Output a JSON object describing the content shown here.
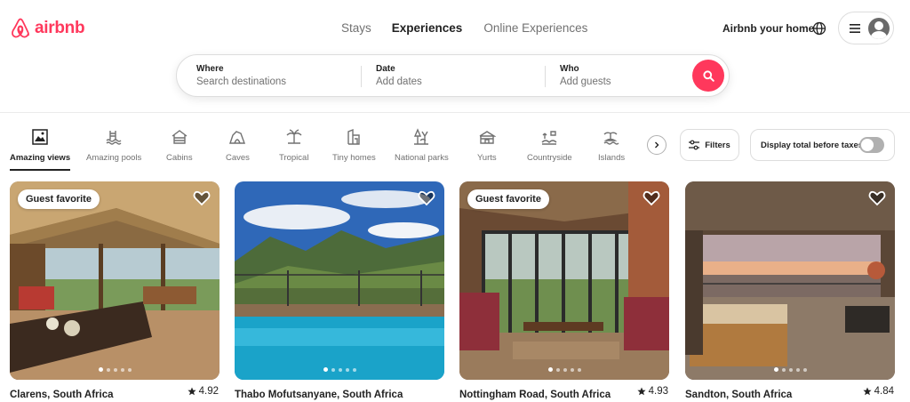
{
  "colors": {
    "brand": "#FF385C",
    "text": "#222222",
    "muted": "#717171",
    "border": "#DDDDDD"
  },
  "header": {
    "logo_text": "airbnb",
    "tabs": [
      {
        "label": "Stays",
        "selected": false
      },
      {
        "label": "Experiences",
        "selected": true
      },
      {
        "label": "Online Experiences",
        "selected": false
      }
    ],
    "host_link": "Airbnb your home",
    "globe_icon": "globe-icon",
    "menu_icon": "hamburger-icon",
    "avatar_icon": "user-avatar-icon"
  },
  "search": {
    "where": {
      "label": "Where",
      "placeholder": "Search destinations"
    },
    "date": {
      "label": "Date",
      "placeholder": "Add dates"
    },
    "who": {
      "label": "Who",
      "placeholder": "Add guests"
    },
    "button_icon": "search-icon"
  },
  "categories": [
    {
      "label": "Amazing views",
      "icon": "amazing-views-icon",
      "active": true
    },
    {
      "label": "Amazing pools",
      "icon": "pool-icon",
      "active": false
    },
    {
      "label": "Cabins",
      "icon": "cabin-icon",
      "active": false
    },
    {
      "label": "Caves",
      "icon": "cave-icon",
      "active": false
    },
    {
      "label": "Tropical",
      "icon": "palm-tree-icon",
      "active": false
    },
    {
      "label": "Tiny homes",
      "icon": "tiny-home-icon",
      "active": false
    },
    {
      "label": "National parks",
      "icon": "national-park-icon",
      "active": false
    },
    {
      "label": "Yurts",
      "icon": "yurt-icon",
      "active": false
    },
    {
      "label": "Countryside",
      "icon": "countryside-icon",
      "active": false
    },
    {
      "label": "Islands",
      "icon": "island-icon",
      "active": false
    }
  ],
  "filters": {
    "label": "Filters",
    "icon": "filters-icon"
  },
  "tax_toggle": {
    "label": "Display total before taxes",
    "on": false
  },
  "listings": [
    {
      "location": "Clarens, South Africa",
      "rating": "4.92",
      "badge": "Guest favorite",
      "photo_count": 5,
      "active_photo": 1
    },
    {
      "location": "Thabo Mofutsanyane, South Africa",
      "rating": "",
      "badge": "",
      "photo_count": 5,
      "active_photo": 1
    },
    {
      "location": "Nottingham Road, South Africa",
      "rating": "4.93",
      "badge": "Guest favorite",
      "photo_count": 5,
      "active_photo": 1
    },
    {
      "location": "Sandton, South Africa",
      "rating": "4.84",
      "badge": "",
      "photo_count": 5,
      "active_photo": 1
    }
  ]
}
